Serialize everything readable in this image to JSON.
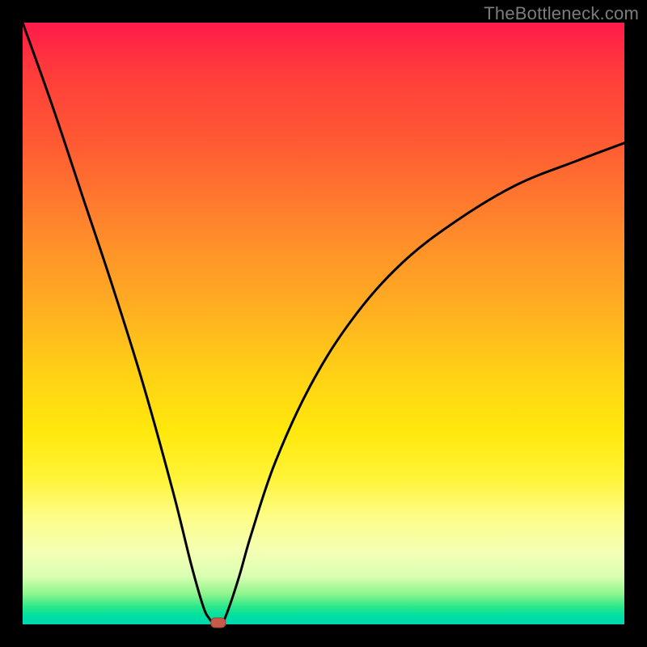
{
  "watermark": "TheBottleneck.com",
  "chart_data": {
    "type": "line",
    "title": "",
    "xlabel": "",
    "ylabel": "",
    "xlim": [
      0,
      100
    ],
    "ylim": [
      0,
      100
    ],
    "grid": false,
    "legend": false,
    "series": [
      {
        "name": "bottleneck-curve",
        "x": [
          0,
          5,
          10,
          15,
          20,
          25,
          28,
          30,
          31,
          32,
          33,
          34,
          36,
          38,
          42,
          48,
          55,
          63,
          72,
          82,
          92,
          100
        ],
        "y": [
          100,
          86,
          71,
          56,
          40,
          22,
          10,
          3,
          1,
          0,
          0,
          2,
          8,
          15,
          27,
          40,
          51,
          60,
          67,
          73,
          77,
          80
        ]
      }
    ],
    "marker": {
      "x": 32.5,
      "y": 0
    },
    "colors": {
      "gradient_top": "#ff1a4b",
      "gradient_mid": "#ffe80c",
      "gradient_bottom": "#00d6b2",
      "curve": "#000000",
      "marker": "#c55a4a",
      "frame": "#000000"
    }
  }
}
